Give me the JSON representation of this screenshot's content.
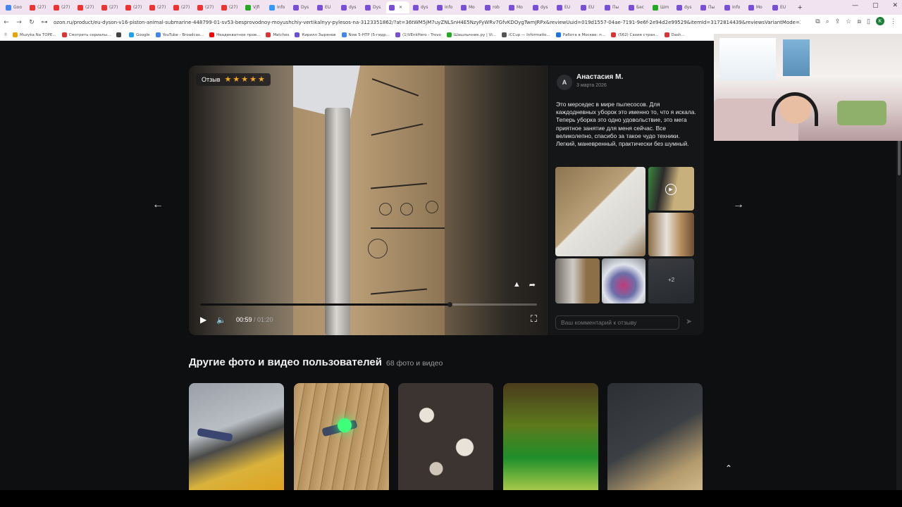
{
  "browser": {
    "tabs": [
      "Goo",
      "(27)",
      "(27)",
      "(27)",
      "(27)",
      "(27)",
      "(27)",
      "(27)",
      "(27)",
      "(27)",
      "Vjfi",
      "Info",
      "Dys",
      "EU",
      "dys",
      "Dys",
      "",
      "dys",
      "Info",
      "Mo",
      "rob",
      "Mo",
      "dys",
      "EU",
      "EU",
      "Пы",
      "Бес",
      "Шm",
      "dys",
      "Пы",
      "Info",
      "Mo",
      "EU"
    ],
    "url": "ozon.ru/product/eu-dyson-v16-piston-animal-submarine-448799-01-sv53-besprovodnoy-moyushchiy-vertikalnyy-pylesos-na-3123351862/?at=36tWM5jM7uyZNLSnH4E5NzyFyWRv7GfvKDOygTwmJRPx&reviewUuid=019d1557-04ae-7191-9e6f-2e94d2e99529&itemId=3172814439&reviewsVariantMode=2",
    "avatar_letter": "K",
    "bookmarks": [
      "Muzyka Na TOPE...",
      "Смотреть сериалы...",
      "",
      "Google",
      "YouTube - Broadcas...",
      "Неадекватное пров...",
      "Matches",
      "Кирилл Зырянов",
      "Now 5-HTP (5-гидр...",
      "(1)VEnkHero - Trovo",
      "Шашлычник.ру | Vi...",
      "iCCup — Informatio...",
      "Работа в Москве: п...",
      "(562) Сахия стран...",
      "Dash..."
    ]
  },
  "video": {
    "review_badge": "Отзыв",
    "rating": 5,
    "current_time": "00:59",
    "separator": " / ",
    "duration": "01:20",
    "progress": 0.74
  },
  "review": {
    "avatar_letter": "А",
    "author": "Анастасия М.",
    "date": "3 марта 2026",
    "text": "Это мерседес в мире пылесосов. Для каждодневных уборок это именно то, что я искала. Теперь уборка это одно удовольствие, это мега приятное занятие для меня сейчас. Все великолепно, спасибо за такое чудо техники. Легкий, маневренный, практически без шумный.",
    "more_count": "+2",
    "comment_placeholder": "Ваш комментарий к отзыву"
  },
  "gallery": {
    "title": "Другие фото и видео пользователей",
    "count": "68 фото и видео"
  },
  "colors": {
    "page_bg": "#0e0f11",
    "star": "#f5a623",
    "panel_bg": "#151618"
  }
}
